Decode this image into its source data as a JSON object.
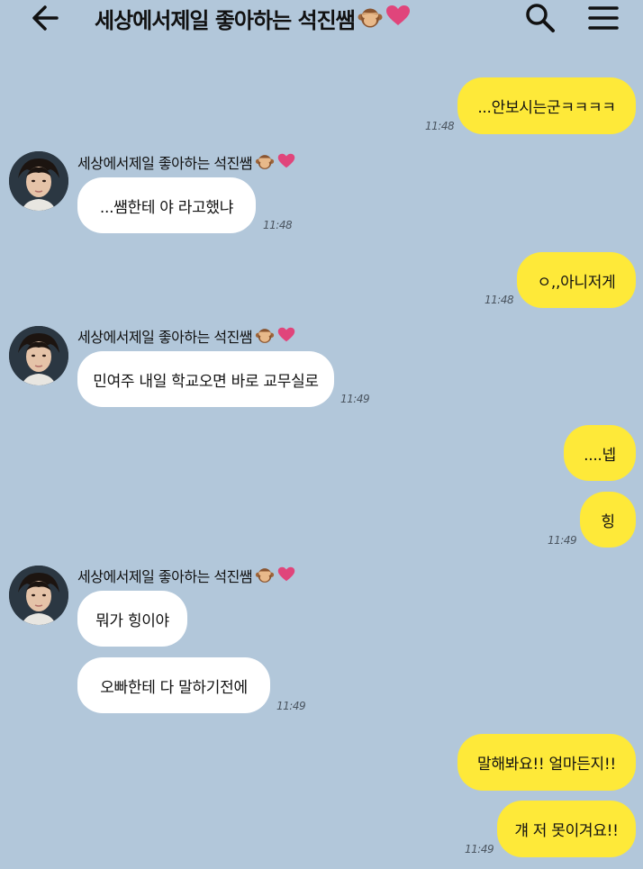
{
  "header": {
    "title": "세상에서제일 좋아하는 석진쌤",
    "back_icon": "arrow-left-icon",
    "search_icon": "search-icon",
    "menu_icon": "hamburger-menu-icon"
  },
  "colors": {
    "background": "#b2c7da",
    "my_bubble": "#fee939",
    "their_bubble": "#ffffff",
    "heart": "#e0457b"
  },
  "sender_name": "세상에서제일 좋아하는 석진쌤",
  "messages": [
    {
      "from": "me",
      "text": "...안보시는군ㅋㅋㅋㅋ",
      "time": "11:48"
    },
    {
      "from": "them",
      "text": "...쌤한테 야 라고했냐",
      "time": "11:48"
    },
    {
      "from": "me",
      "text": "ㅇ,,아니저게",
      "time": "11:48"
    },
    {
      "from": "them",
      "text": "민여주 내일 학교오면 바로 교무실로",
      "time": "11:49"
    },
    {
      "from": "me",
      "text": "....넵"
    },
    {
      "from": "me",
      "text": "힝",
      "time": "11:49"
    },
    {
      "from": "them",
      "text": "뭐가 힝이야"
    },
    {
      "from": "them",
      "text": "오빠한테 다 말하기전에",
      "time": "11:49"
    },
    {
      "from": "me",
      "text": "말해봐요!! 얼마든지!!"
    },
    {
      "from": "me",
      "text": "걔 저 못이겨요!!",
      "time": "11:49"
    }
  ]
}
